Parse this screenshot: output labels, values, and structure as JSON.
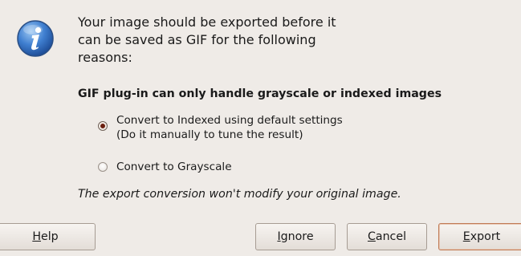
{
  "dialog": {
    "message": "Your image should be exported before it\ncan be saved as GIF for the following\nreasons:",
    "reason_title": "GIF plug-in can only handle grayscale or indexed images",
    "options": [
      {
        "line1": "Convert to Indexed using default settings",
        "line2": "(Do it manually to tune the result)",
        "selected": true
      },
      {
        "line1": "Convert to Grayscale",
        "selected": false
      }
    ],
    "note": "The export conversion won't modify your original image.",
    "icon": "info-icon"
  },
  "buttons": {
    "help": {
      "mnemonic": "H",
      "rest": "elp"
    },
    "ignore": {
      "mnemonic": "I",
      "rest": "gnore"
    },
    "cancel": {
      "mnemonic": "C",
      "rest": "ancel"
    },
    "export": {
      "mnemonic": "E",
      "rest": "xport"
    }
  },
  "colors": {
    "background": "#efebe7",
    "icon_blue": "#2f6fc4",
    "radio_dot": "#6b1f0f"
  }
}
